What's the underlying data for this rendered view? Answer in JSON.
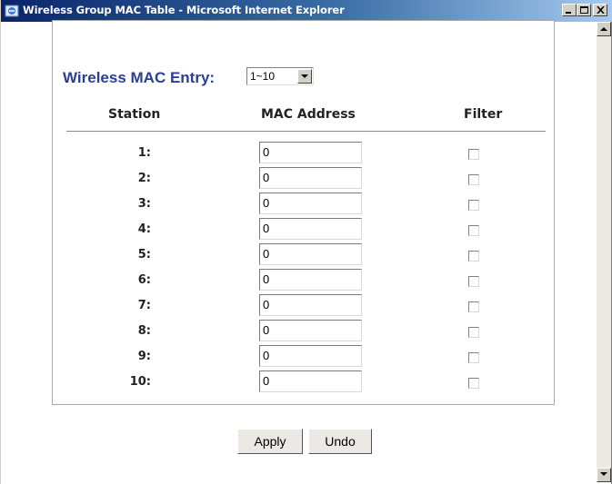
{
  "window": {
    "title": "Wireless Group MAC Table - Microsoft Internet Explorer",
    "controls": {
      "minimize": "minimize-icon",
      "maximize": "maximize-icon",
      "close": "close-icon"
    }
  },
  "entry": {
    "label": "Wireless MAC Entry:",
    "selected": "1~10"
  },
  "table": {
    "headers": {
      "station": "Station",
      "mac": "MAC Address",
      "filter": "Filter"
    },
    "rows": [
      {
        "station": "1:",
        "mac": "0",
        "filter": false
      },
      {
        "station": "2:",
        "mac": "0",
        "filter": false
      },
      {
        "station": "3:",
        "mac": "0",
        "filter": false
      },
      {
        "station": "4:",
        "mac": "0",
        "filter": false
      },
      {
        "station": "5:",
        "mac": "0",
        "filter": false
      },
      {
        "station": "6:",
        "mac": "0",
        "filter": false
      },
      {
        "station": "7:",
        "mac": "0",
        "filter": false
      },
      {
        "station": "8:",
        "mac": "0",
        "filter": false
      },
      {
        "station": "9:",
        "mac": "0",
        "filter": false
      },
      {
        "station": "10:",
        "mac": "0",
        "filter": false
      }
    ]
  },
  "buttons": {
    "apply": "Apply",
    "undo": "Undo"
  },
  "colors": {
    "title_bar": "#0a246a",
    "entry_label": "#2c3e94"
  }
}
